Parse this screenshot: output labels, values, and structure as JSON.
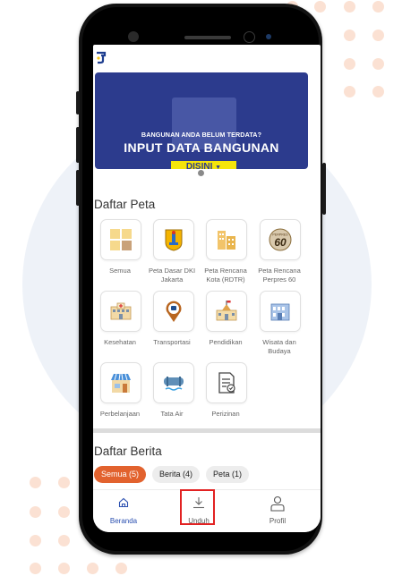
{
  "banner": {
    "subtitle": "BANGUNAN ANDA BELUM TERDATA?",
    "title": "INPUT DATA BANGUNAN",
    "button": "DISINI"
  },
  "map_section": {
    "title": "Daftar Peta",
    "items": [
      {
        "label": "Semua",
        "icon": "grid-icon"
      },
      {
        "label": "Peta Dasar DKI Jakarta",
        "icon": "jakarta-emblem-icon"
      },
      {
        "label": "Peta Rencana Kota (RDTR)",
        "icon": "city-buildings-icon"
      },
      {
        "label": "Peta Rencana Perpres 60",
        "icon": "perpres-60-icon"
      },
      {
        "label": "Kesehatan",
        "icon": "hospital-icon"
      },
      {
        "label": "Transportasi",
        "icon": "bus-pin-icon"
      },
      {
        "label": "Pendidikan",
        "icon": "school-icon"
      },
      {
        "label": "Wisata dan Budaya",
        "icon": "museum-icon"
      },
      {
        "label": "Perbelanjaan",
        "icon": "shop-icon"
      },
      {
        "label": "Tata Air",
        "icon": "water-pipe-icon"
      },
      {
        "label": "Perizinan",
        "icon": "permit-document-icon"
      }
    ],
    "perpres_badge": "60",
    "perpres_badge_small": "PERPRES"
  },
  "news_section": {
    "title": "Daftar Berita",
    "filters": [
      {
        "label": "Semua (5)",
        "active": true
      },
      {
        "label": "Berita (4)",
        "active": false
      },
      {
        "label": "Peta (1)",
        "active": false
      }
    ]
  },
  "bottom_nav": [
    {
      "label": "Beranda",
      "icon": "home-icon",
      "active": true
    },
    {
      "label": "Unduh",
      "icon": "download-icon",
      "active": false
    },
    {
      "label": "Profil",
      "icon": "user-icon",
      "active": false
    }
  ],
  "colors": {
    "accent": "#e2622e",
    "banner_bg": "#2c3b8d",
    "banner_button": "#f5e50a",
    "nav_active": "#2a4fb0",
    "highlight": "#e22222"
  }
}
